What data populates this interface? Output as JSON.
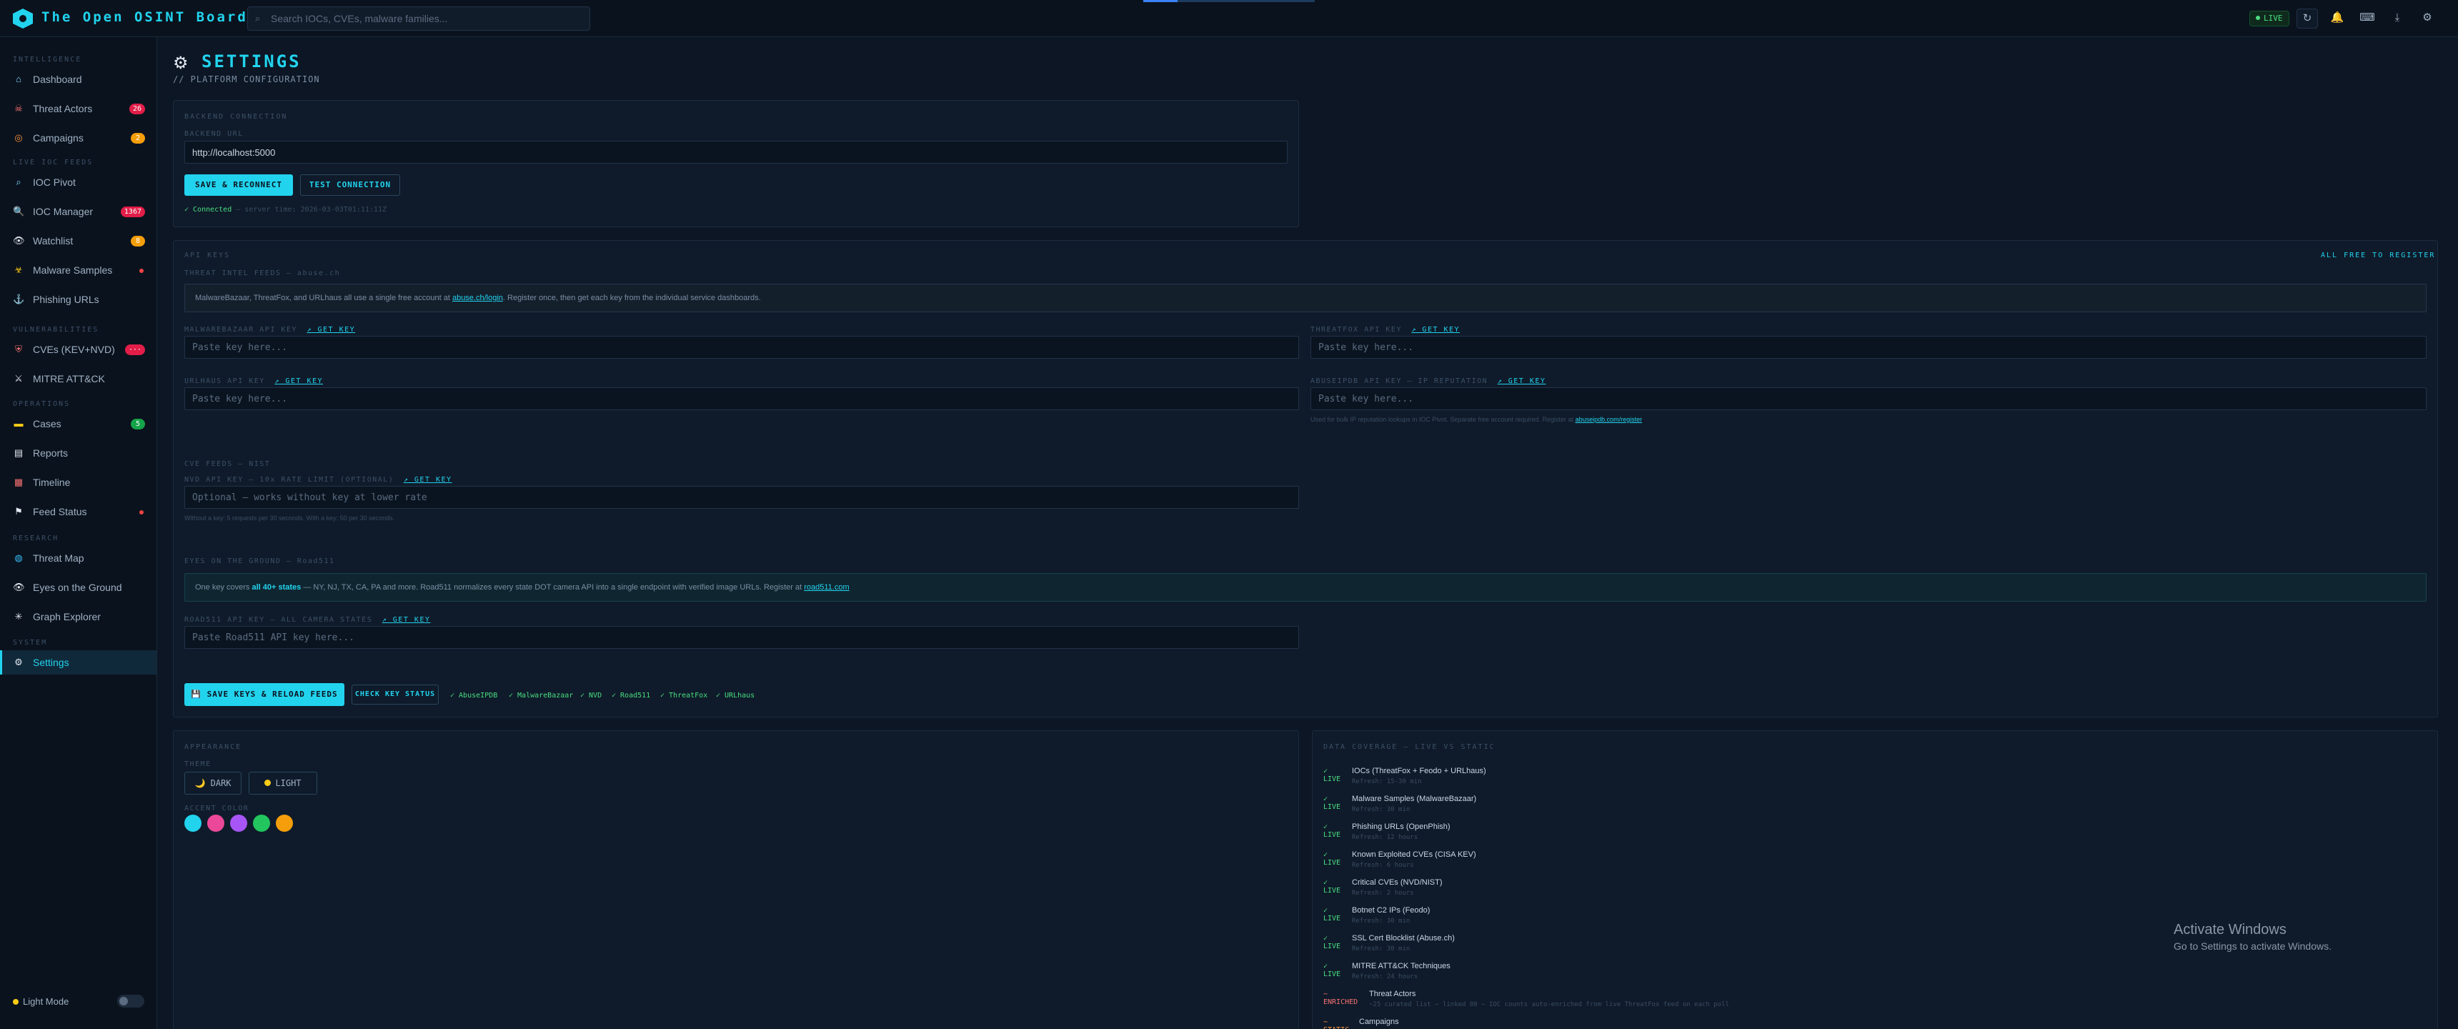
{
  "app": {
    "title": "The Open OSINT Board",
    "search_placeholder": "Search IOCs, CVEs, malware families...",
    "live_label": "LIVE",
    "loading_progress": 0.2,
    "accent_color": "#22d3ee"
  },
  "topbar_icons": [
    "refresh-icon",
    "bell-icon",
    "keyboard-icon",
    "download-icon",
    "gear-icon"
  ],
  "sidebar": {
    "sections": {
      "intelligence": "INTELLIGENCE",
      "live_iocs": "LIVE IOC FEEDS",
      "vulns": "VULNERABILITIES",
      "operations": "OPERATIONS",
      "research": "RESEARCH",
      "system": "SYSTEM"
    },
    "items": {
      "dashboard": {
        "label": "Dashboard"
      },
      "threat_actors": {
        "label": "Threat Actors",
        "badge": "26"
      },
      "campaigns": {
        "label": "Campaigns",
        "badge": "2"
      },
      "ioc_pivot": {
        "label": "IOC Pivot"
      },
      "ioc_manager": {
        "label": "IOC Manager",
        "badge": "1367"
      },
      "watchlist": {
        "label": "Watchlist",
        "badge": "8"
      },
      "malware_samples": {
        "label": "Malware Samples"
      },
      "phishing_urls": {
        "label": "Phishing URLs"
      },
      "cves": {
        "label": "CVEs (KEV+NVD)",
        "badge": "···"
      },
      "mitre": {
        "label": "MITRE ATT&CK"
      },
      "cases": {
        "label": "Cases",
        "badge": "5"
      },
      "reports": {
        "label": "Reports"
      },
      "timeline": {
        "label": "Timeline"
      },
      "feed_status": {
        "label": "Feed Status"
      },
      "threat_map": {
        "label": "Threat Map"
      },
      "eyes_on_ground": {
        "label": "Eyes on the Ground"
      },
      "graph_explorer": {
        "label": "Graph Explorer"
      },
      "settings": {
        "label": "Settings"
      }
    },
    "light_mode_label": "Light Mode"
  },
  "page": {
    "title": "SETTINGS",
    "subtitle": "// PLATFORM CONFIGURATION"
  },
  "backend": {
    "title": "BACKEND CONNECTION",
    "url_label": "BACKEND URL",
    "url_value": "http://localhost:5000",
    "save_button": "SAVE & RECONNECT",
    "test_button": "TEST CONNECTION",
    "status_ok": "✓ Connected",
    "status_detail": "— server time: 2026-03-03T01:11:11Z"
  },
  "api_keys": {
    "title": "API KEYS",
    "free_note": "ALL FREE TO REGISTER",
    "threat_intel_title": "THREAT INTEL FEEDS — abuse.ch",
    "abuse_info_prefix": "MalwareBazaar, ThreatFox, and URLhaus all use a single free account at",
    "abuse_info_link": "abuse.ch/login",
    "abuse_info_suffix": ". Register once, then get each key from the individual service dashboards.",
    "malwarebazaar_label": "MALWAREBAZAAR API KEY",
    "threatfox_label": "THREATFOX API KEY",
    "urlhaus_label": "URLHAUS API KEY",
    "abuseipdb_label": "ABUSEIPDB API KEY — IP REPUTATION",
    "get_key": "↗ GET KEY",
    "paste_placeholder": "Paste key here...",
    "abuseipdb_note_prefix": "Used for bulk IP reputation lookups in IOC Pivot. Separate free account required. Register at",
    "abuseipdb_note_link": "abuseipdb.com/register",
    "cve_title": "CVE FEEDS — NIST",
    "nvd_label": "NVD API KEY — 10x RATE LIMIT (OPTIONAL)",
    "nvd_placeholder": "Optional — works without key at lower rate",
    "nvd_note": "Without a key: 5 requests per 30 seconds. With a key: 50 per 30 seconds.",
    "eyes_title": "EYES ON THE GROUND — Road511",
    "road_info_prefix": "One key covers",
    "road_info_bold": "all 40+ states",
    "road_info_mid": "— NY, NJ, TX, CA, PA and more. Road511 normalizes every state DOT camera API into a single endpoint with verified image URLs. Register at",
    "road_info_link": "road511.com",
    "road_label": "ROAD511 API KEY — ALL CAMERA STATES",
    "road_placeholder": "Paste Road511 API key here...",
    "save_button": "💾 SAVE KEYS & RELOAD FEEDS",
    "check_button": "CHECK KEY STATUS",
    "statuses": [
      "✓ AbuseIPDB",
      "✓ MalwareBazaar",
      "✓ NVD",
      "✓ Road511",
      "✓ ThreatFox",
      "✓ URLhaus"
    ]
  },
  "appearance": {
    "title": "APPEARANCE",
    "theme_label": "THEME",
    "dark": "🌙 DARK",
    "light": "LIGHT",
    "accent_label": "ACCENT COLOR",
    "accents": [
      "#22d3ee",
      "#ec4899",
      "#a855f7",
      "#22c55e",
      "#f59e0b"
    ]
  },
  "coverage": {
    "title": "DATA COVERAGE — LIVE VS STATIC",
    "rows": [
      {
        "status": "✓ LIVE",
        "name": "IOCs (ThreatFox + Feodo + URLhaus)",
        "refresh": "Refresh: 15-30 min"
      },
      {
        "status": "✓ LIVE",
        "name": "Malware Samples (MalwareBazaar)",
        "refresh": "Refresh: 30 min"
      },
      {
        "status": "✓ LIVE",
        "name": "Phishing URLs (OpenPhish)",
        "refresh": "Refresh: 12 hours"
      },
      {
        "status": "✓ LIVE",
        "name": "Known Exploited CVEs (CISA KEV)",
        "refresh": "Refresh: 6 hours"
      },
      {
        "status": "✓ LIVE",
        "name": "Critical CVEs (NVD/NIST)",
        "refresh": "Refresh: 2 hours"
      },
      {
        "status": "✓ LIVE",
        "name": "Botnet C2 IPs (Feodo)",
        "refresh": "Refresh: 30 min"
      },
      {
        "status": "✓ LIVE",
        "name": "SSL Cert Blocklist (Abuse.ch)",
        "refresh": "Refresh: 30 min"
      },
      {
        "status": "✓ LIVE",
        "name": "MITRE ATT&CK Techniques",
        "refresh": "Refresh: 24 hours"
      },
      {
        "status": "~ ENRICHED",
        "name": "Threat Actors",
        "refresh": "~25 curated list — linked 80 — IOC counts auto-enriched from live ThreatFox feed on each poll"
      },
      {
        "status": "~ STATIC",
        "name": "Campaigns",
        "refresh": ""
      }
    ]
  },
  "watermark": {
    "title": "Activate Windows",
    "subtitle": "Go to Settings to activate Windows."
  }
}
